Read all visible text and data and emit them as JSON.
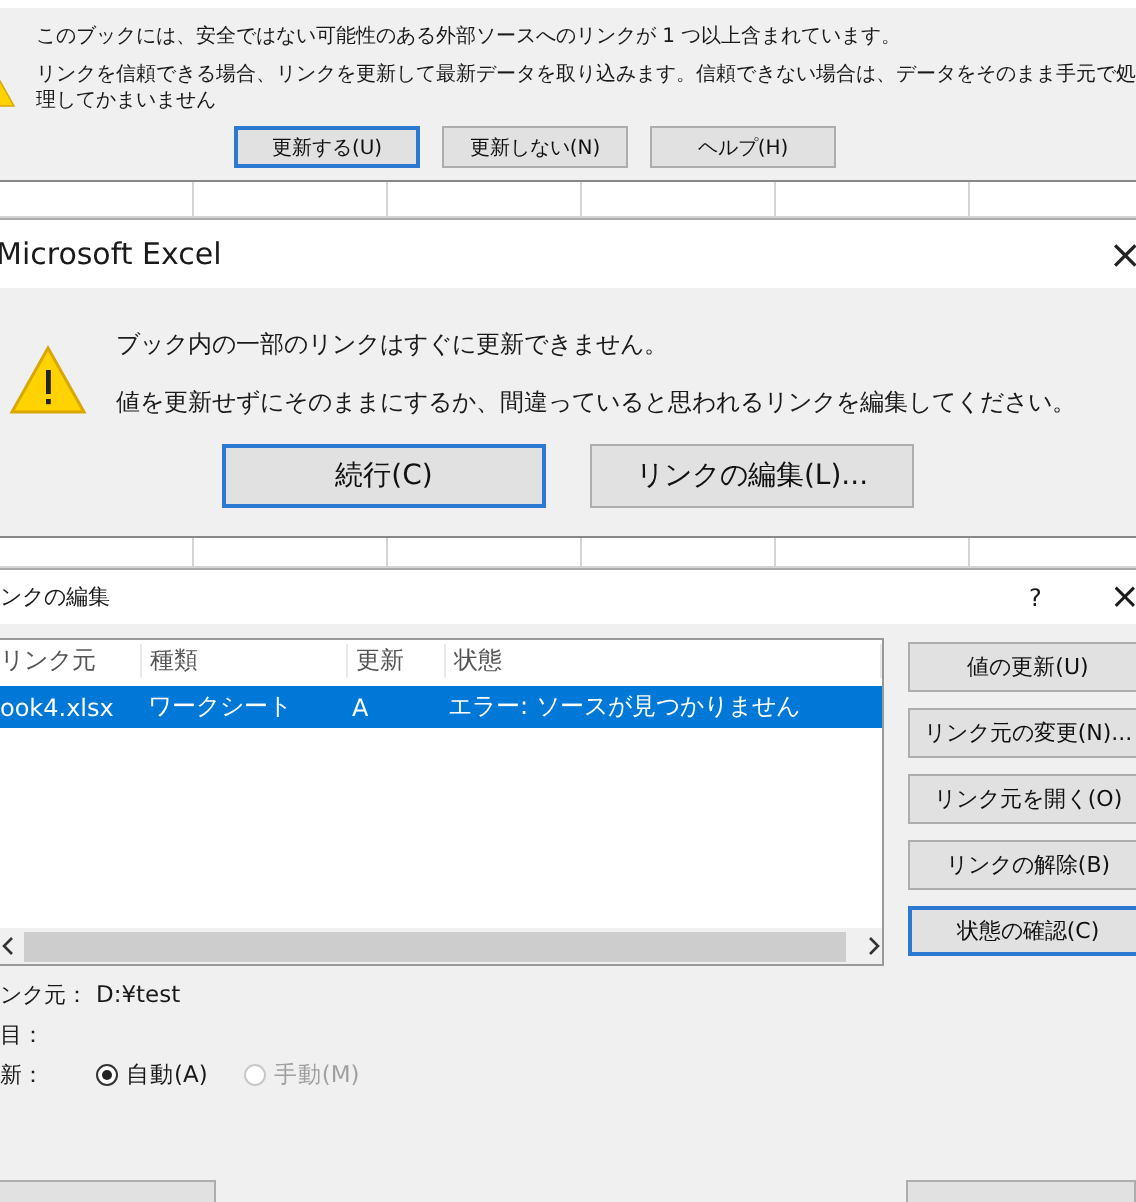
{
  "update_warning_dialog": {
    "messages": [
      "このブックには、安全ではない可能性のある外部ソースへのリンクが 1 つ以上含まれています。",
      "リンクを信頼できる場合、リンクを更新して最新データを取り込みます。信頼できない場合は、データをそのまま手元で処理してかまいません"
    ],
    "buttons": [
      {
        "label": "更新する(U)",
        "default": true
      },
      {
        "label": "更新しない(N)",
        "default": false
      },
      {
        "label": "ヘルプ(H)",
        "default": false
      }
    ]
  },
  "excel_dialog": {
    "title": "Microsoft Excel",
    "close": "×",
    "messages": [
      "ブック内の一部のリンクはすぐに更新できません。",
      "値を更新せずにそのままにするか、間違っていると思われるリンクを編集してください。"
    ],
    "buttons": [
      {
        "label": "続行(C)",
        "default": true
      },
      {
        "label": "リンクの編集(L)...",
        "default": false
      }
    ]
  },
  "edit_links_dialog": {
    "title": "ンクの編集",
    "help": "?",
    "close": "×",
    "columns": [
      "リンク元",
      "種類",
      "更新",
      "状態"
    ],
    "rows": [
      {
        "cells": [
          "ook4.xlsx",
          "ワークシート",
          "A",
          "エラー: ソースが見つかりません"
        ],
        "selected": true
      }
    ],
    "buttons": [
      {
        "label": "値の更新(U)",
        "default": false
      },
      {
        "label": "リンク元の変更(N)...",
        "default": false
      },
      {
        "label": "リンク元を開く(O)",
        "default": false
      },
      {
        "label": "リンクの解除(B)",
        "default": false
      },
      {
        "label": "状態の確認(C)",
        "default": true
      }
    ],
    "details": [
      {
        "label": "ンク元：",
        "value": "D:¥test"
      },
      {
        "label": "目："
      }
    ],
    "update": {
      "label": "新：",
      "options": [
        {
          "label": "自動(A)",
          "selected": true,
          "disabled": false
        },
        {
          "label": "手動(M)",
          "selected": false,
          "disabled": true
        }
      ]
    },
    "bottom_buttons": [
      {
        "kind": "button"
      },
      {
        "kind": "button"
      }
    ]
  }
}
